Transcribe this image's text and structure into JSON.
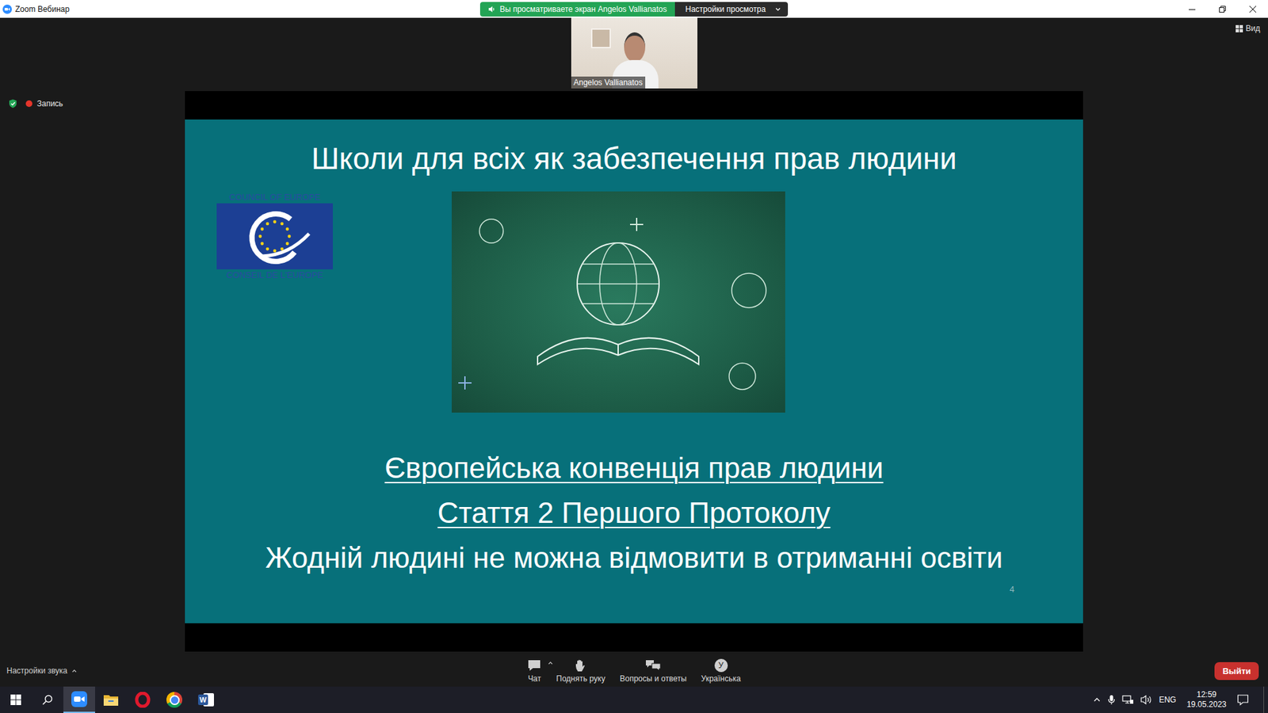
{
  "window": {
    "title": "Zoom Вебинар"
  },
  "share_banner": {
    "text": "Вы просматриваете экран Angelos Vallianatos",
    "settings": "Настройки просмотра"
  },
  "view_button": {
    "label": "Вид"
  },
  "recording": {
    "label": "Запись",
    "on": true
  },
  "speaker": {
    "name": "Angelos Vallianatos"
  },
  "slide": {
    "title": "Школи для всіх як забезпечення прав людини",
    "logo": {
      "top": "COUNCIL OF EUROPE",
      "bottom": "CONSEIL DE L'EUROPE"
    },
    "lines": [
      {
        "text": "Європейська конвенція прав людини",
        "underlined": true
      },
      {
        "text": "Стаття 2 Першого Протоколу",
        "underlined": true
      },
      {
        "text": "Жодній людині не можна відмовити в отриманні освіти",
        "underlined": false
      }
    ],
    "page": "4"
  },
  "audio_settings": {
    "label": "Настройки звука"
  },
  "toolbar": [
    {
      "kind": "chat",
      "label": "Чат",
      "has_menu": true
    },
    {
      "kind": "hand",
      "label": "Поднять руку",
      "has_menu": false
    },
    {
      "kind": "qa",
      "label": "Вопросы и ответы",
      "has_menu": false
    },
    {
      "kind": "language",
      "label": "Українська",
      "badge": "У",
      "has_menu": false
    }
  ],
  "leave_button": {
    "label": "Выйти"
  },
  "taskbar": {
    "apps": [
      {
        "kind": "zoom",
        "active": true
      },
      {
        "kind": "explorer",
        "active": false
      },
      {
        "kind": "opera",
        "active": false
      },
      {
        "kind": "chrome",
        "active": false
      },
      {
        "kind": "word",
        "glyph": "W",
        "active": false
      }
    ],
    "language": "ENG",
    "time": "12:59",
    "date": "19.05.2023"
  }
}
